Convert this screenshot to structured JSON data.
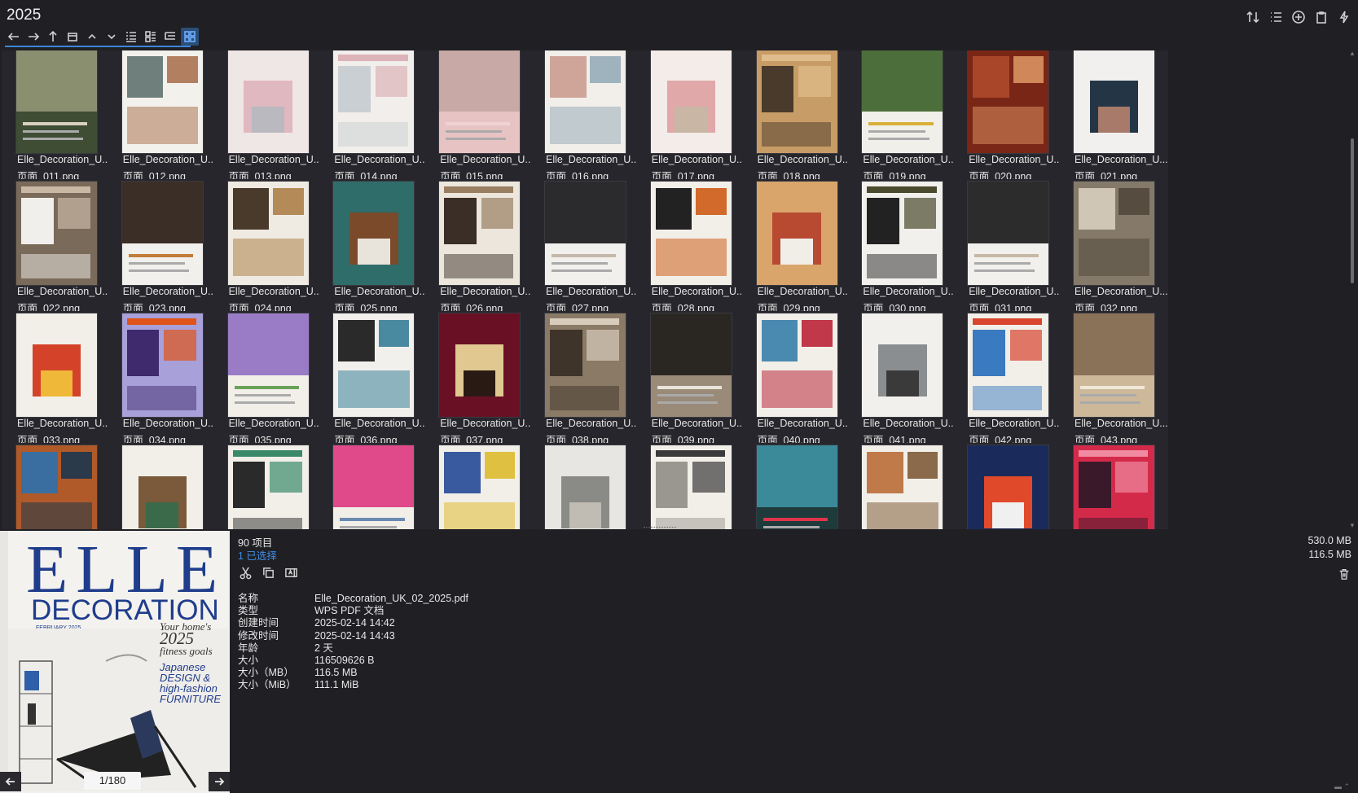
{
  "window": {
    "title": "2025"
  },
  "toolbar": {
    "nav_icons": [
      "back-arrow-icon",
      "forward-arrow-icon",
      "up-arrow-icon",
      "window-icon",
      "chevron-up-icon",
      "chevron-down-icon",
      "list-view-icon",
      "detail-view-icon",
      "tree-view-icon",
      "grid-view-icon"
    ],
    "right_icons": [
      "sort-icon",
      "list-icon",
      "add-circle-icon",
      "clipboard-icon",
      "quick-action-icon"
    ]
  },
  "files": [
    {
      "name": "Elle_Decoration_U...",
      "page": "页面_011.png",
      "palette": [
        "#3e4d34",
        "#8a8f70",
        "#d8d0c0"
      ]
    },
    {
      "name": "Elle_Decoration_U...",
      "page": "页面_012.png",
      "palette": [
        "#f3f1ec",
        "#6f7f7c",
        "#b28060"
      ]
    },
    {
      "name": "Elle_Decoration_U...",
      "page": "页面_013.png",
      "palette": [
        "#efe6e6",
        "#e0b8c0",
        "#b9b9bf"
      ]
    },
    {
      "name": "Elle_Decoration_U...",
      "page": "页面_014.png",
      "palette": [
        "#f1eeec",
        "#dcb3b8",
        "#c9cfd2"
      ]
    },
    {
      "name": "Elle_Decoration_U...",
      "page": "页面_015.png",
      "palette": [
        "#e8c3c3",
        "#c8a9a6",
        "#f0d2d3"
      ]
    },
    {
      "name": "Elle_Decoration_U...",
      "page": "页面_016.png",
      "palette": [
        "#f2eeea",
        "#cfa59a",
        "#9eb3bd"
      ]
    },
    {
      "name": "Elle_Decoration_U...",
      "page": "页面_017.png",
      "palette": [
        "#f3ece8",
        "#e0a8a8",
        "#c9b6a4"
      ]
    },
    {
      "name": "Elle_Decoration_U...",
      "page": "页面_018.png",
      "palette": [
        "#c89c66",
        "#e0bd8c",
        "#4a3a2c"
      ]
    },
    {
      "name": "Elle_Decoration_U...",
      "page": "页面_019.png",
      "palette": [
        "#f1efe9",
        "#4c6e3a",
        "#d8b038"
      ]
    },
    {
      "name": "Elle_Decoration_U...",
      "page": "页面_020.png",
      "palette": [
        "#7a2616",
        "#a9462a",
        "#d0875a"
      ]
    },
    {
      "name": "Elle_Decoration_U...",
      "page": "页面_021.png",
      "palette": [
        "#f1f0ee",
        "#243646",
        "#a87a6a"
      ]
    },
    {
      "name": "Elle_Decoration_U...",
      "page": "页面_022.png",
      "palette": [
        "#7a6a5a",
        "#c9b8a4",
        "#f1efec"
      ]
    },
    {
      "name": "Elle_Decoration_U...",
      "page": "页面_023.png",
      "palette": [
        "#f2f0ec",
        "#3b2e26",
        "#c27c3a"
      ]
    },
    {
      "name": "Elle_Decoration_U...",
      "page": "页面_024.png",
      "palette": [
        "#f0ebe2",
        "#4a3a2c",
        "#b48a58"
      ]
    },
    {
      "name": "Elle_Decoration_U...",
      "page": "页面_025.png",
      "palette": [
        "#2f6d6a",
        "#7a4a2a",
        "#e8e4dc"
      ]
    },
    {
      "name": "Elle_Decoration_U...",
      "page": "页面_026.png",
      "palette": [
        "#ece6dc",
        "#9a7e62",
        "#3a2e26"
      ]
    },
    {
      "name": "Elle_Decoration_U...",
      "page": "页面_027.png",
      "palette": [
        "#f2f0ec",
        "#2b2b2e",
        "#c4b8aa"
      ]
    },
    {
      "name": "Elle_Decoration_U...",
      "page": "页面_028.png",
      "palette": [
        "#f2efe9",
        "#222",
        "#d16a2a"
      ]
    },
    {
      "name": "Elle_Decoration_U...",
      "page": "页面_029.png",
      "palette": [
        "#d9a56b",
        "#b94a32",
        "#f1eee8"
      ]
    },
    {
      "name": "Elle_Decoration_U...",
      "page": "页面_030.png",
      "palette": [
        "#f2f0ec",
        "#4a4a2e",
        "#222"
      ]
    },
    {
      "name": "Elle_Decoration_U...",
      "page": "页面_031.png",
      "palette": [
        "#f2f0ec",
        "#2c2c2c",
        "#c7b8a6"
      ]
    },
    {
      "name": "Elle_Decoration_U...",
      "page": "页面_032.png",
      "palette": [
        "#857a6a",
        "#cfc6b6",
        "#574c40"
      ]
    },
    {
      "name": "Elle_Decoration_U...",
      "page": "页面_033.png",
      "palette": [
        "#f2efe9",
        "#d4422a",
        "#f0b838"
      ]
    },
    {
      "name": "Elle_Decoration_U...",
      "page": "页面_034.png",
      "palette": [
        "#a8a0d8",
        "#e0541a",
        "#3f2a6e"
      ]
    },
    {
      "name": "Elle_Decoration_U...",
      "page": "页面_035.png",
      "palette": [
        "#f2efe9",
        "#9a7cc6",
        "#6aa25a"
      ]
    },
    {
      "name": "Elle_Decoration_U...",
      "page": "页面_036.png",
      "palette": [
        "#f2f0ec",
        "#2a2a2a",
        "#4a8aa0"
      ]
    },
    {
      "name": "Elle_Decoration_U...",
      "page": "页面_037.png",
      "palette": [
        "#6a1024",
        "#e0c890",
        "#2a1a14"
      ]
    },
    {
      "name": "Elle_Decoration_U...",
      "page": "页面_038.png",
      "palette": [
        "#8a7a66",
        "#d8ccbc",
        "#3e342a"
      ]
    },
    {
      "name": "Elle_Decoration_U...",
      "page": "页面_039.png",
      "palette": [
        "#9a8a78",
        "#2a2622",
        "#e8e4dc"
      ]
    },
    {
      "name": "Elle_Decoration_U...",
      "page": "页面_040.png",
      "palette": [
        "#f2efe9",
        "#4a8ab0",
        "#c0384a"
      ]
    },
    {
      "name": "Elle_Decoration_U...",
      "page": "页面_041.png",
      "palette": [
        "#f2f0ec",
        "#8a8e90",
        "#3a3a3a"
      ]
    },
    {
      "name": "Elle_Decoration_U...",
      "page": "页面_042.png",
      "palette": [
        "#f2efe9",
        "#d8442e",
        "#3a7ac0"
      ]
    },
    {
      "name": "Elle_Decoration_U...",
      "page": "页面_043.png",
      "palette": [
        "#cdb89a",
        "#8a7258",
        "#f0e8d8"
      ]
    },
    {
      "name": "",
      "page": "",
      "palette": [
        "#b05a2a",
        "#3a6ea0",
        "#2a3a4a"
      ]
    },
    {
      "name": "",
      "page": "",
      "palette": [
        "#f2efe9",
        "#7a5a3a",
        "#3a6a4a"
      ]
    },
    {
      "name": "",
      "page": "",
      "palette": [
        "#f2efe9",
        "#3a8a6a",
        "#2a2a2a"
      ]
    },
    {
      "name": "",
      "page": "",
      "palette": [
        "#f2efe9",
        "#e04a8a",
        "#6a8ab0"
      ]
    },
    {
      "name": "",
      "page": "",
      "palette": [
        "#f2efe9",
        "#3a5aa0",
        "#e0c040"
      ]
    },
    {
      "name": "",
      "page": "",
      "palette": [
        "#e8e6e2",
        "#8a8a86",
        "#c0bcb4"
      ]
    },
    {
      "name": "",
      "page": "",
      "palette": [
        "#f2efe9",
        "#3a3a3a",
        "#9a9690"
      ]
    },
    {
      "name": "",
      "page": "",
      "palette": [
        "#1e3a3a",
        "#3a8a9a",
        "#e0344a"
      ]
    },
    {
      "name": "",
      "page": "",
      "palette": [
        "#f2efe9",
        "#c07a4a",
        "#8a6a4a"
      ]
    },
    {
      "name": "",
      "page": "",
      "palette": [
        "#1a2a5a",
        "#e04a2a",
        "#f0f0f0"
      ]
    },
    {
      "name": "",
      "page": "",
      "palette": [
        "#d42a4a",
        "#f08aa0",
        "#3a1a2a"
      ]
    }
  ],
  "preview": {
    "cover_title": "ELLE",
    "cover_subtitle": "DECORATION",
    "cover_date": "FEBRUARY 2025",
    "cover_line1": "Your home's",
    "cover_line2": "2025",
    "cover_line3": "fitness goals",
    "cover_line4": "Japanese",
    "cover_line5": "DESIGN &",
    "cover_line6": "high-fashion",
    "cover_line7": "FURNITURE",
    "page_indicator": "1/180"
  },
  "info": {
    "item_count": "90 项目",
    "selected": "1 已选择",
    "total_size": "530.0 MB",
    "selected_size": "116.5 MB",
    "properties": [
      {
        "label": "名称",
        "value": "Elle_Decoration_UK_02_2025.pdf"
      },
      {
        "label": "类型",
        "value": "WPS PDF 文档"
      },
      {
        "label": "创建时间",
        "value": "2025-02-14  14:42"
      },
      {
        "label": "修改时间",
        "value": "2025-02-14  14:43"
      },
      {
        "label": "年龄",
        "value": "2 天"
      },
      {
        "label": "大小",
        "value": "116509626 B"
      },
      {
        "label": "大小（MB）",
        "value": "116.5 MB"
      },
      {
        "label": "大小（MiB）",
        "value": "111.1 MiB"
      }
    ]
  },
  "colors": {
    "accent": "#3d8ee6",
    "background": "#1f1f24",
    "tile": "#26262c"
  }
}
